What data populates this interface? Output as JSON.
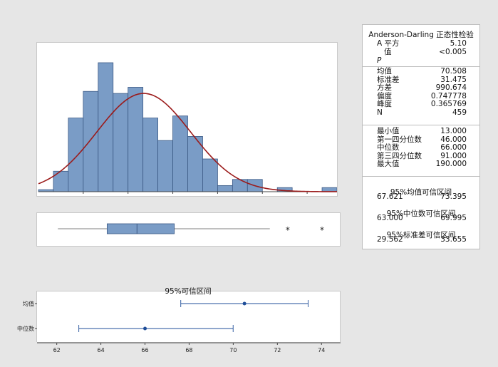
{
  "chart_data": [
    {
      "type": "bar",
      "title": "",
      "x_ticks": [
        30,
        60,
        90,
        120,
        150,
        180
      ],
      "xlim": [
        0,
        200
      ],
      "bin_edges": [
        0,
        10,
        20,
        30,
        40,
        50,
        60,
        70,
        80,
        90,
        100,
        110,
        120,
        130,
        140,
        150,
        160,
        170,
        180,
        190,
        200
      ],
      "counts": [
        1,
        10,
        36,
        49,
        63,
        48,
        51,
        36,
        25,
        37,
        27,
        16,
        3,
        6,
        6,
        0,
        2,
        0,
        0,
        2
      ],
      "fit_curve": {
        "mean": 70.508,
        "sd": 31.475
      },
      "ylim": [
        0,
        63
      ],
      "bar_color": "#7a9cc6",
      "curve_color": "#9b1b1b"
    },
    {
      "type": "boxplot",
      "min": 13.0,
      "q1": 46.0,
      "median": 66.0,
      "q3": 91.0,
      "whisker_high": 155,
      "outliers": [
        167,
        190
      ],
      "xlim": [
        0,
        200
      ]
    },
    {
      "type": "interval",
      "title": "95%可信区间",
      "x_ticks": [
        62,
        64,
        66,
        68,
        70,
        72,
        74
      ],
      "xlim": [
        61.3,
        74.8
      ],
      "rows": [
        {
          "label": "均值",
          "point": 70.508,
          "low": 67.621,
          "high": 73.395
        },
        {
          "label": "中位数",
          "point": 66.0,
          "low": 63.0,
          "high": 69.995
        }
      ],
      "color": "#1f4e99"
    }
  ],
  "stats": {
    "ad_title": "Anderson-Darling 正态性检验",
    "ad_rows": [
      {
        "label": "A 平方",
        "value": "5.10"
      },
      {
        "label": "值",
        "value": "<0.005"
      }
    ],
    "p_label": "P",
    "desc_rows": [
      {
        "label": "均值",
        "value": "70.508"
      },
      {
        "label": "标准差",
        "value": "31.475"
      },
      {
        "label": "方差",
        "value": "990.674"
      },
      {
        "label": "偏度",
        "value": "0.747778"
      },
      {
        "label": "峰度",
        "value": "0.365769"
      },
      {
        "label": "N",
        "value": "459"
      }
    ],
    "quant_rows": [
      {
        "label": "最小值",
        "value": "13.000"
      },
      {
        "label": "第一四分位数",
        "value": "46.000"
      },
      {
        "label": "中位数",
        "value": "66.000"
      },
      {
        "label": "第三四分位数",
        "value": "91.000"
      },
      {
        "label": "最大值",
        "value": "190.000"
      }
    ],
    "ci_blocks": [
      {
        "label": "95%均值可信区间",
        "low": "67.621",
        "high": "73.395"
      },
      {
        "label": "95%中位数可信区间",
        "low": "63.000",
        "high": "69.995"
      },
      {
        "label": "95%标准差可信区间",
        "low": "29.562",
        "high": "33.655"
      }
    ]
  }
}
